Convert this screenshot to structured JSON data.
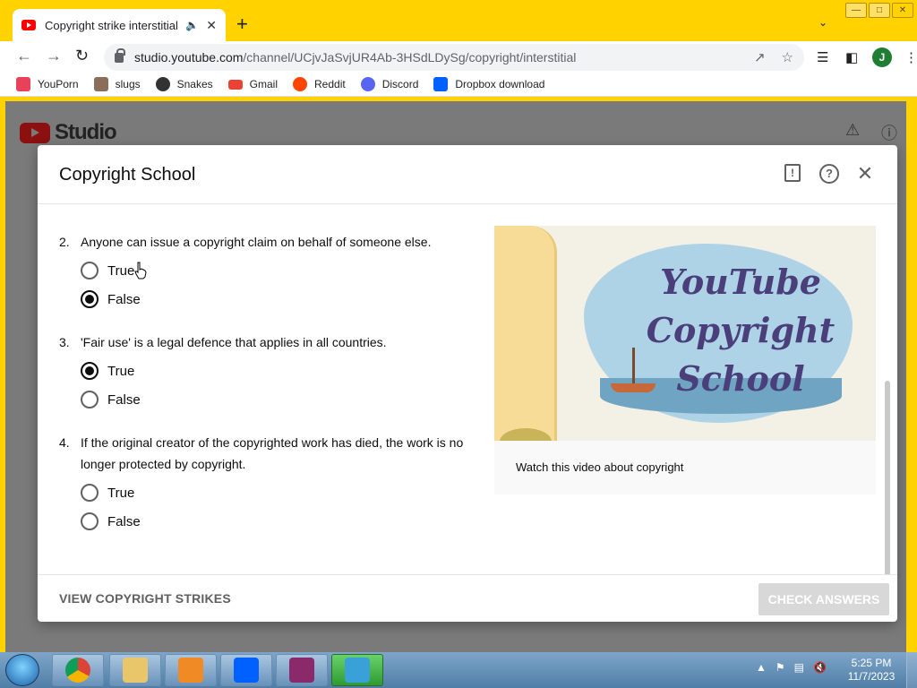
{
  "browser": {
    "tab_title": "Copyright strike interstitial -",
    "audio_icon": "speaker-icon",
    "new_tab_label": "+",
    "url_host": "studio.youtube.com",
    "url_path": "/channel/UCjvJaSvjUR4Ab-3HSdLDySg/copyright/interstitial",
    "profile_initial": "J"
  },
  "bookmarks": [
    {
      "label": "YouPorn",
      "color": "#e8425b"
    },
    {
      "label": "slugs",
      "color": "#8a6d5b"
    },
    {
      "label": "Snakes",
      "color": "#333333"
    },
    {
      "label": "Gmail",
      "color": "#ea4335"
    },
    {
      "label": "Reddit",
      "color": "#ff4500"
    },
    {
      "label": "Discord",
      "color": "#5865f2"
    },
    {
      "label": "Dropbox download",
      "color": "#0061ff"
    }
  ],
  "studio": {
    "logo_text": "Studio"
  },
  "dialog": {
    "title": "Copyright School",
    "questions": [
      {
        "number": "2.",
        "text": "Anyone can issue a copyright claim on behalf of someone else.",
        "options": [
          {
            "label": "True",
            "selected": false
          },
          {
            "label": "False",
            "selected": true
          }
        ]
      },
      {
        "number": "3.",
        "text": "'Fair use' is a legal defence that applies in all countries.",
        "options": [
          {
            "label": "True",
            "selected": true
          },
          {
            "label": "False",
            "selected": false
          }
        ]
      },
      {
        "number": "4.",
        "text": "If the original creator of the copyrighted work has died, the work is no longer protected by copyright.",
        "options": [
          {
            "label": "True",
            "selected": false
          },
          {
            "label": "False",
            "selected": false
          }
        ]
      }
    ],
    "video": {
      "thumbnail_text_1": "YouTube",
      "thumbnail_text_2": "Copyright",
      "thumbnail_text_3": "School",
      "caption": "Watch this video about copyright"
    },
    "footer": {
      "view_strikes_label": "VIEW COPYRIGHT STRIKES",
      "check_answers_label": "CHECK ANSWERS"
    }
  },
  "taskbar": {
    "time": "5:25 PM",
    "date": "11/7/2023"
  }
}
